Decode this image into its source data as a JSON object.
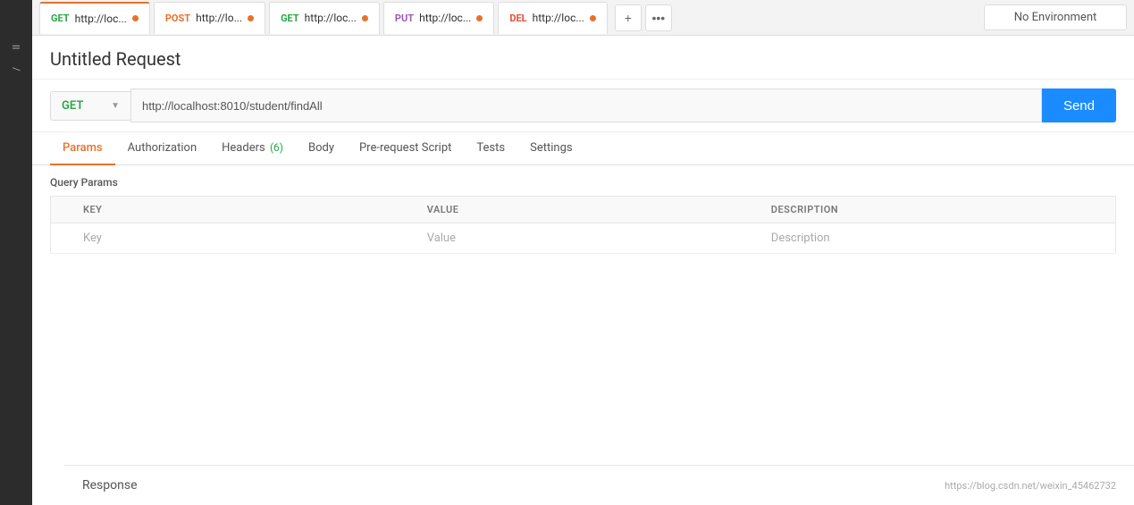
{
  "sidebar": {
    "text1": "ll",
    "text2": "/"
  },
  "env": {
    "label": "No Environment"
  },
  "tabs": [
    {
      "method": "GET",
      "method_class": "method-get",
      "url": "http://loc...",
      "dot_class": "dot-orange",
      "active": true
    },
    {
      "method": "POST",
      "method_class": "method-post",
      "url": "http://lo...",
      "dot_class": "dot-orange",
      "active": false
    },
    {
      "method": "GET",
      "method_class": "method-get",
      "url": "http://loc...",
      "dot_class": "dot-orange",
      "active": false
    },
    {
      "method": "PUT",
      "method_class": "method-put",
      "url": "http://loc...",
      "dot_class": "dot-orange",
      "active": false
    },
    {
      "method": "DEL",
      "method_class": "method-del",
      "url": "http://loc...",
      "dot_class": "dot-orange",
      "active": false
    }
  ],
  "request": {
    "title": "Untitled Request",
    "method": "GET",
    "url": "http://localhost:8010/student/findAll",
    "send_label": "Send"
  },
  "req_tabs": [
    {
      "id": "params",
      "label": "Params",
      "badge": null,
      "active": true
    },
    {
      "id": "authorization",
      "label": "Authorization",
      "badge": null,
      "active": false
    },
    {
      "id": "headers",
      "label": "Headers",
      "badge": "(6)",
      "active": false
    },
    {
      "id": "body",
      "label": "Body",
      "badge": null,
      "active": false
    },
    {
      "id": "pre-request-script",
      "label": "Pre-request Script",
      "badge": null,
      "active": false
    },
    {
      "id": "tests",
      "label": "Tests",
      "badge": null,
      "active": false
    },
    {
      "id": "settings",
      "label": "Settings",
      "badge": null,
      "active": false
    }
  ],
  "query_params": {
    "section_title": "Query Params",
    "columns": [
      "KEY",
      "VALUE",
      "DESCRIPTION"
    ],
    "placeholder_row": {
      "key": "Key",
      "value": "Value",
      "description": "Description"
    }
  },
  "response": {
    "title": "Response",
    "link_text": "https://blog.csdn.net/weixin_45462732"
  }
}
